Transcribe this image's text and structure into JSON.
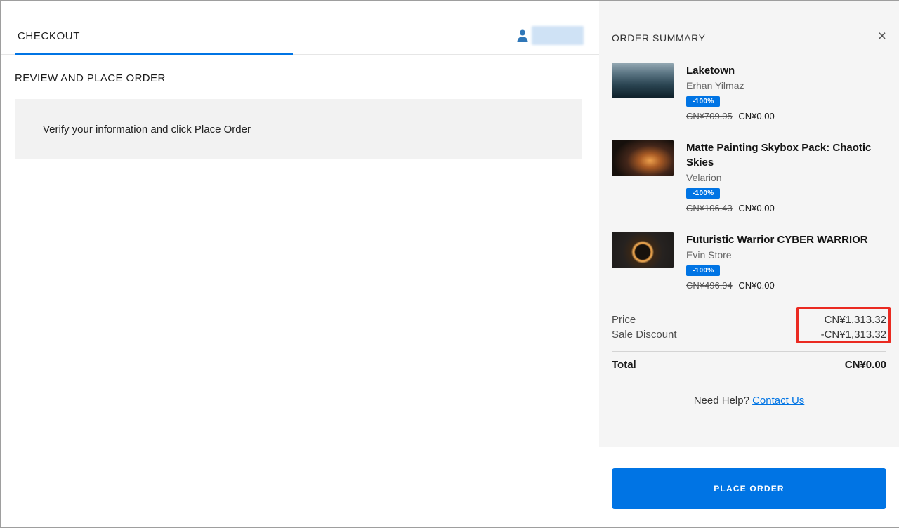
{
  "checkout": {
    "tab_label": "CHECKOUT",
    "section_title": "REVIEW AND PLACE ORDER",
    "notice": "Verify your information and click Place Order"
  },
  "order_summary": {
    "title": "ORDER SUMMARY",
    "close_label": "×",
    "items": [
      {
        "title": "Laketown",
        "seller": "Erhan Yilmaz",
        "discount": "-100%",
        "original_price": "CN¥709.95",
        "price": "CN¥0.00",
        "thumbnail": "laketown-dark-city-thumbnail"
      },
      {
        "title": "Matte Painting Skybox Pack: Chaotic Skies",
        "seller": "Velarion",
        "discount": "-100%",
        "original_price": "CN¥106.43",
        "price": "CN¥0.00",
        "thumbnail": "chaotic-skies-fiery-sky-thumbnail"
      },
      {
        "title": "Futuristic Warrior CYBER WARRIOR",
        "seller": "Evin Store",
        "discount": "-100%",
        "original_price": "CN¥496.94",
        "price": "CN¥0.00",
        "thumbnail": "cyber-warrior-orange-ring-thumbnail"
      }
    ],
    "price_label": "Price",
    "price_value": "CN¥1,313.32",
    "discount_label": "Sale Discount",
    "discount_value": "-CN¥1,313.32",
    "total_label": "Total",
    "total_value": "CN¥0.00",
    "help_text": "Need Help?",
    "help_link": "Contact Us",
    "place_order_label": "PLACE ORDER"
  },
  "colors": {
    "accent_blue": "#0074e4",
    "annotation_red": "#ea2a21",
    "panel_gray": "#f5f5f5",
    "notice_gray": "#f2f2f2",
    "user_redaction_blue": "#cfe2f5"
  }
}
